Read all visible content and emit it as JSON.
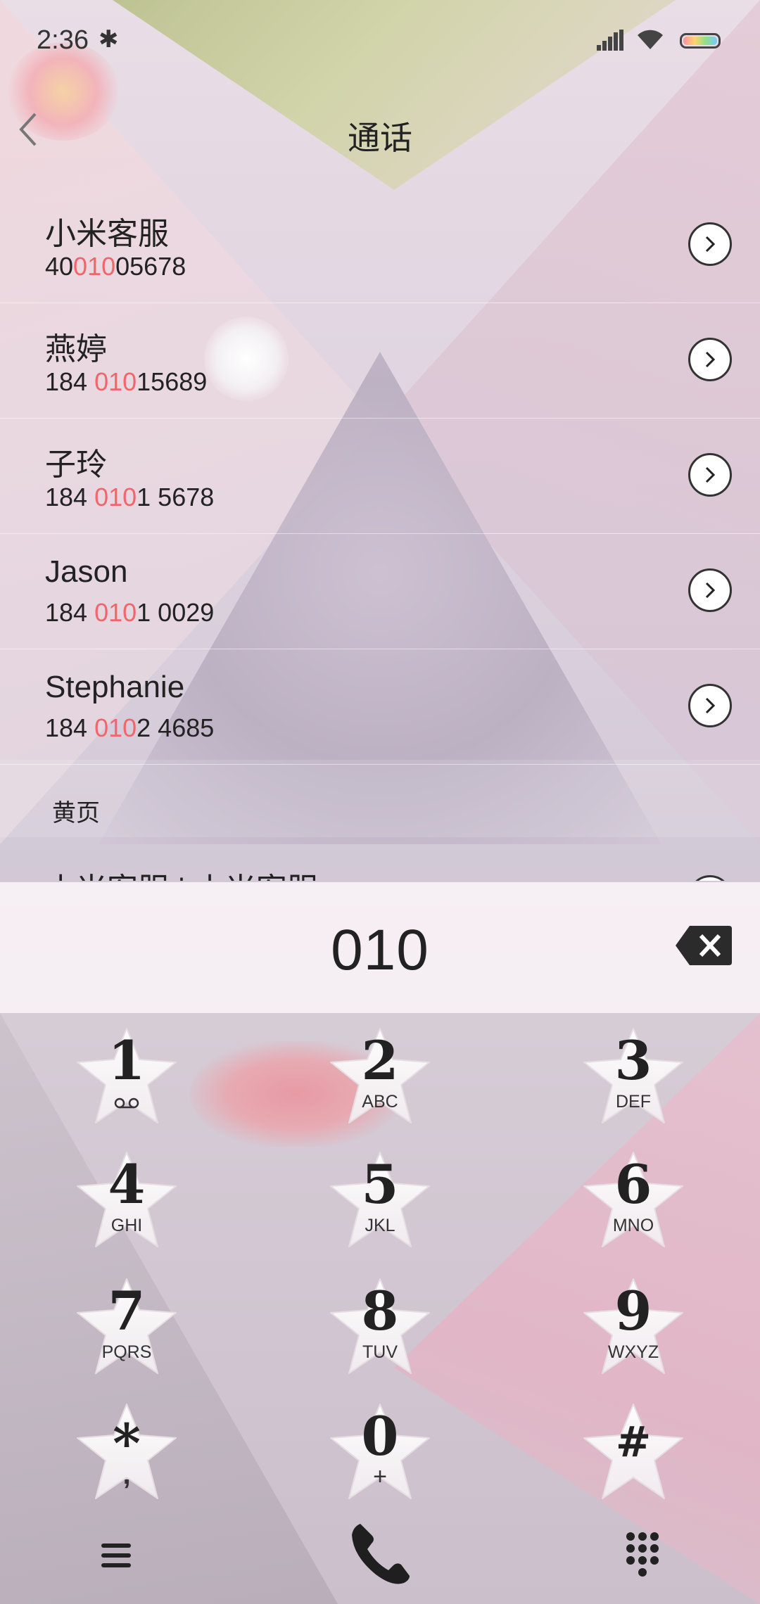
{
  "status_bar": {
    "time": "2:36"
  },
  "title_bar": {
    "title": "通话"
  },
  "results": [
    {
      "name": "小米客服",
      "number_pre": "40",
      "number_hl": "010",
      "number_post": "05678"
    },
    {
      "name": "燕婷",
      "number_pre": "184 ",
      "number_hl": "010",
      "number_post": "15689"
    },
    {
      "name": "子玲",
      "number_pre": "184 ",
      "number_hl": "010",
      "number_post": "1 5678"
    },
    {
      "name": "Jason",
      "number_pre": "184 ",
      "number_hl": "010",
      "number_post": "1 0029"
    },
    {
      "name": "Stephanie",
      "number_pre": "184 ",
      "number_hl": "010",
      "number_post": "2 4685"
    }
  ],
  "yellow_pages": {
    "label": "黄页",
    "partial_item": "小米客服 | 小米客服"
  },
  "dial": {
    "digits": "010"
  },
  "keypad": [
    {
      "digit": "1",
      "letters": ""
    },
    {
      "digit": "2",
      "letters": "ABC"
    },
    {
      "digit": "3",
      "letters": "DEF"
    },
    {
      "digit": "4",
      "letters": "GHI"
    },
    {
      "digit": "5",
      "letters": "JKL"
    },
    {
      "digit": "6",
      "letters": "MNO"
    },
    {
      "digit": "7",
      "letters": "PQRS"
    },
    {
      "digit": "8",
      "letters": "TUV"
    },
    {
      "digit": "9",
      "letters": "WXYZ"
    },
    {
      "digit": "*",
      "letters": ","
    },
    {
      "digit": "0",
      "letters": "+"
    },
    {
      "digit": "#",
      "letters": ""
    }
  ],
  "colors": {
    "highlight": "#f0666b",
    "text": "#222222"
  },
  "icons": {
    "back": "chevron-left-icon",
    "detail": "chevron-right-circle-icon",
    "delete": "backspace-icon",
    "voicemail": "voicemail-icon",
    "menu": "hamburger-icon",
    "call": "phone-icon",
    "dialpad": "dialpad-icon"
  }
}
